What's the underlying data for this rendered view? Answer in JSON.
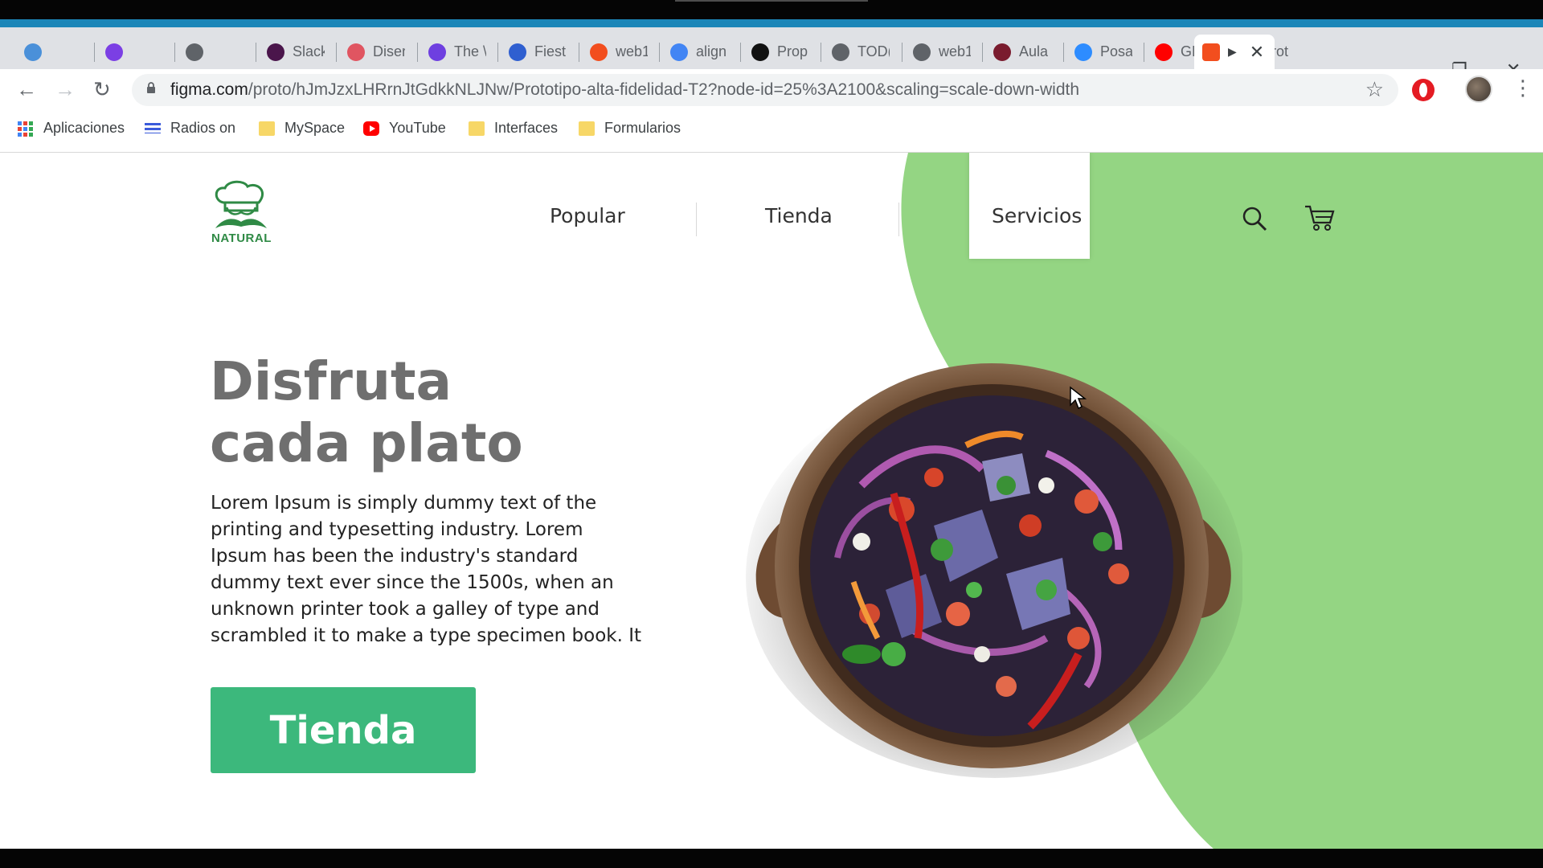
{
  "browser": {
    "tabs": [
      {
        "title": "",
        "favicon": "pinwheel-icon",
        "color": "#4a90d9"
      },
      {
        "title": "",
        "favicon": "g-circle-icon",
        "color": "#7b3fe4"
      },
      {
        "title": "",
        "favicon": "globe-icon",
        "color": "#5f6368"
      },
      {
        "title": "Slack",
        "favicon": "slack-icon",
        "color": "#4a154b"
      },
      {
        "title": "Diser",
        "favicon": "s-icon",
        "color": "#e05561"
      },
      {
        "title": "The \\",
        "favicon": "purple-diamond-icon",
        "color": "#6e3fe0"
      },
      {
        "title": "Fiest",
        "favicon": "shield-u-icon",
        "color": "#2f5fd0"
      },
      {
        "title": "web1",
        "favicon": "figma-icon",
        "color": "#f24e1e"
      },
      {
        "title": "align",
        "favicon": "google-icon",
        "color": "#4285f4"
      },
      {
        "title": "Prop",
        "favicon": "feather-icon",
        "color": "#111111"
      },
      {
        "title": "TOD(",
        "favicon": "globe-icon",
        "color": "#5f6368"
      },
      {
        "title": "web1",
        "favicon": "globe-icon",
        "color": "#5f6368"
      },
      {
        "title": "Aula",
        "favicon": "graduation-cap-icon",
        "color": "#7a1b2e"
      },
      {
        "title": "Posa",
        "favicon": "zoom-icon",
        "color": "#2d8cff"
      },
      {
        "title": "GP d",
        "favicon": "youtube-icon",
        "color": "#ff0000"
      },
      {
        "title": "Prot",
        "favicon": "figma-icon",
        "color": "#f24e1e"
      }
    ],
    "active_tab": {
      "title": "",
      "favicon": "figma-icon"
    },
    "url_domain": "figma.com",
    "url_path": "/proto/hJmJzxLHRrnJtGdkkNLJNw/Prototipo-alta-fidelidad-T2?node-id=25%3A2100&scaling=scale-down-width",
    "bookmarks": [
      {
        "label": "Aplicaciones",
        "icon": "apps-grid-icon"
      },
      {
        "label": "Radios on",
        "icon": "flag-icon"
      },
      {
        "label": "MySpace",
        "icon": "folder-icon"
      },
      {
        "label": "YouTube",
        "icon": "youtube-icon"
      },
      {
        "label": "Interfaces",
        "icon": "folder-icon"
      },
      {
        "label": "Formularios",
        "icon": "folder-icon"
      }
    ]
  },
  "site": {
    "brand": "NATURAL",
    "nav": [
      "Popular",
      "Tienda",
      "Servicios"
    ],
    "hero_title": "Disfruta\ncada plato",
    "hero_body": "Lorem Ipsum is simply dummy text of the printing and typesetting industry. Lorem Ipsum has been the industry's standard dummy text ever since the 1500s, when an unknown printer took a galley of type and scrambled it to make a type specimen book. It",
    "cta_label": "Tienda",
    "colors": {
      "green_bg": "#94d583",
      "cta": "#3cb87c",
      "logo": "#2f8a45",
      "title": "#6f6f6f"
    }
  }
}
